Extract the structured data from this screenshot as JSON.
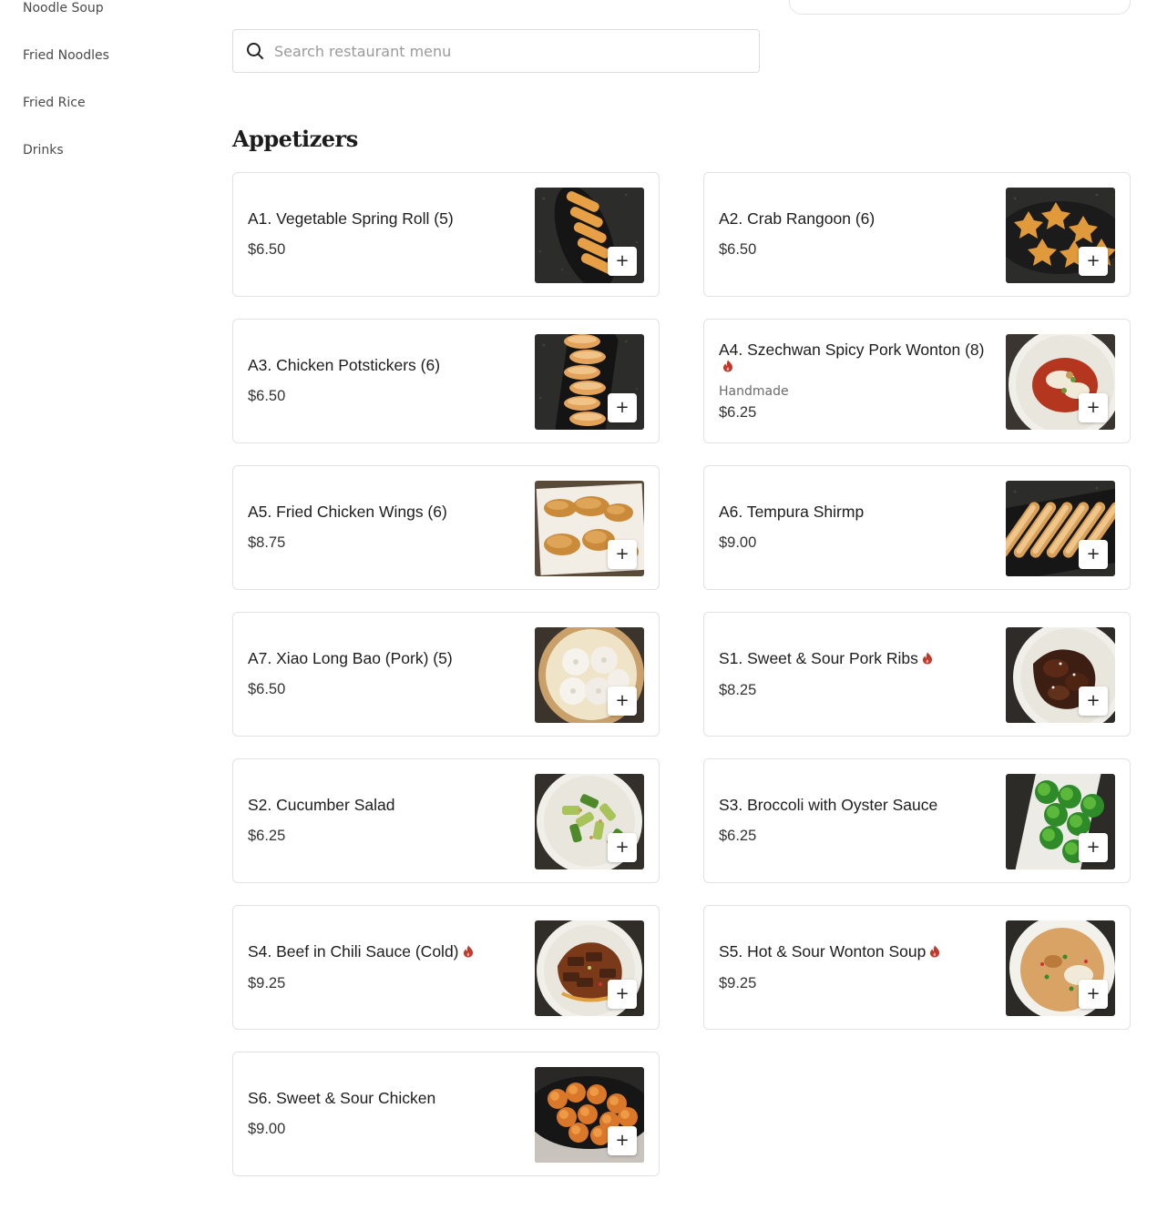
{
  "sidebar": {
    "items": [
      {
        "label": "Noodle Soup"
      },
      {
        "label": "Fried Noodles"
      },
      {
        "label": "Fried Rice"
      },
      {
        "label": "Drinks"
      }
    ]
  },
  "search": {
    "placeholder": "Search restaurant menu",
    "value": ""
  },
  "section": {
    "title": "Appetizers"
  },
  "add_label": "+",
  "colors": {
    "spicy_icon": "#c0392b",
    "card_border": "#e2e2e2"
  },
  "items": [
    {
      "name": "A1. Vegetable Spring Roll (5)",
      "price": "$6.50",
      "spicy": false,
      "description": "",
      "image": "spring-rolls"
    },
    {
      "name": "A2. Crab Rangoon (6)",
      "price": "$6.50",
      "spicy": false,
      "description": "",
      "image": "crab-rangoon"
    },
    {
      "name": "A3. Chicken Potstickers (6)",
      "price": "$6.50",
      "spicy": false,
      "description": "",
      "image": "potstickers"
    },
    {
      "name": "A4. Szechwan Spicy Pork Wonton (8)",
      "price": "$6.25",
      "spicy": true,
      "description": "Handmade",
      "image": "spicy-wonton"
    },
    {
      "name": "A5. Fried Chicken Wings (6)",
      "price": "$8.75",
      "spicy": false,
      "description": "",
      "image": "chicken-wings"
    },
    {
      "name": "A6. Tempura Shirmp",
      "price": "$9.00",
      "spicy": false,
      "description": "",
      "image": "tempura-shrimp"
    },
    {
      "name": "A7. Xiao Long Bao (Pork) (5)",
      "price": "$6.50",
      "spicy": false,
      "description": "",
      "image": "xiao-long-bao"
    },
    {
      "name": "S1. Sweet & Sour Pork Ribs",
      "price": "$8.25",
      "spicy": true,
      "description": "",
      "image": "pork-ribs"
    },
    {
      "name": "S2. Cucumber Salad",
      "price": "$6.25",
      "spicy": false,
      "description": "",
      "image": "cucumber-salad"
    },
    {
      "name": "S3. Broccoli with Oyster Sauce",
      "price": "$6.25",
      "spicy": false,
      "description": "",
      "image": "broccoli"
    },
    {
      "name": "S4. Beef in Chili Sauce (Cold)",
      "price": "$9.25",
      "spicy": true,
      "description": "",
      "image": "beef-chili"
    },
    {
      "name": "S5. Hot & Sour Wonton Soup",
      "price": "$9.25",
      "spicy": true,
      "description": "",
      "image": "wonton-soup"
    },
    {
      "name": "S6. Sweet & Sour Chicken",
      "price": "$9.00",
      "spicy": false,
      "description": "",
      "image": "sweet-sour-chicken"
    }
  ]
}
